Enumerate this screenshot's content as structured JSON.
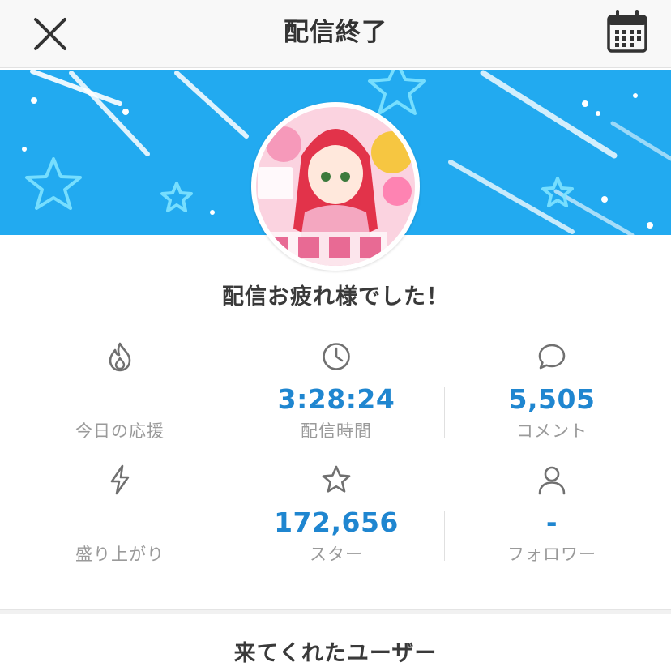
{
  "header": {
    "title": "配信終了",
    "close_icon": "close-icon",
    "calendar_icon": "calendar-icon"
  },
  "banner": {
    "background_color": "#22aaf0",
    "decoration": "stars-and-streaks"
  },
  "avatar": {
    "alt": "配信者のアバター"
  },
  "message": "配信お疲れ様でした！",
  "stats": [
    {
      "icon": "flame-icon",
      "value": "",
      "label": "今日の応援"
    },
    {
      "icon": "clock-icon",
      "value": "3:28:24",
      "label": "配信時間"
    },
    {
      "icon": "comment-icon",
      "value": "5,505",
      "label": "コメント"
    },
    {
      "icon": "lightning-icon",
      "value": "",
      "label": "盛り上がり"
    },
    {
      "icon": "star-icon",
      "value": "172,656",
      "label": "スター"
    },
    {
      "icon": "person-icon",
      "value": "-",
      "label": "フォロワー"
    }
  ],
  "section": {
    "title": "来てくれたユーザー"
  },
  "colors": {
    "accent": "#1f86d0",
    "label": "#9a9a9a",
    "icon": "#707070"
  }
}
